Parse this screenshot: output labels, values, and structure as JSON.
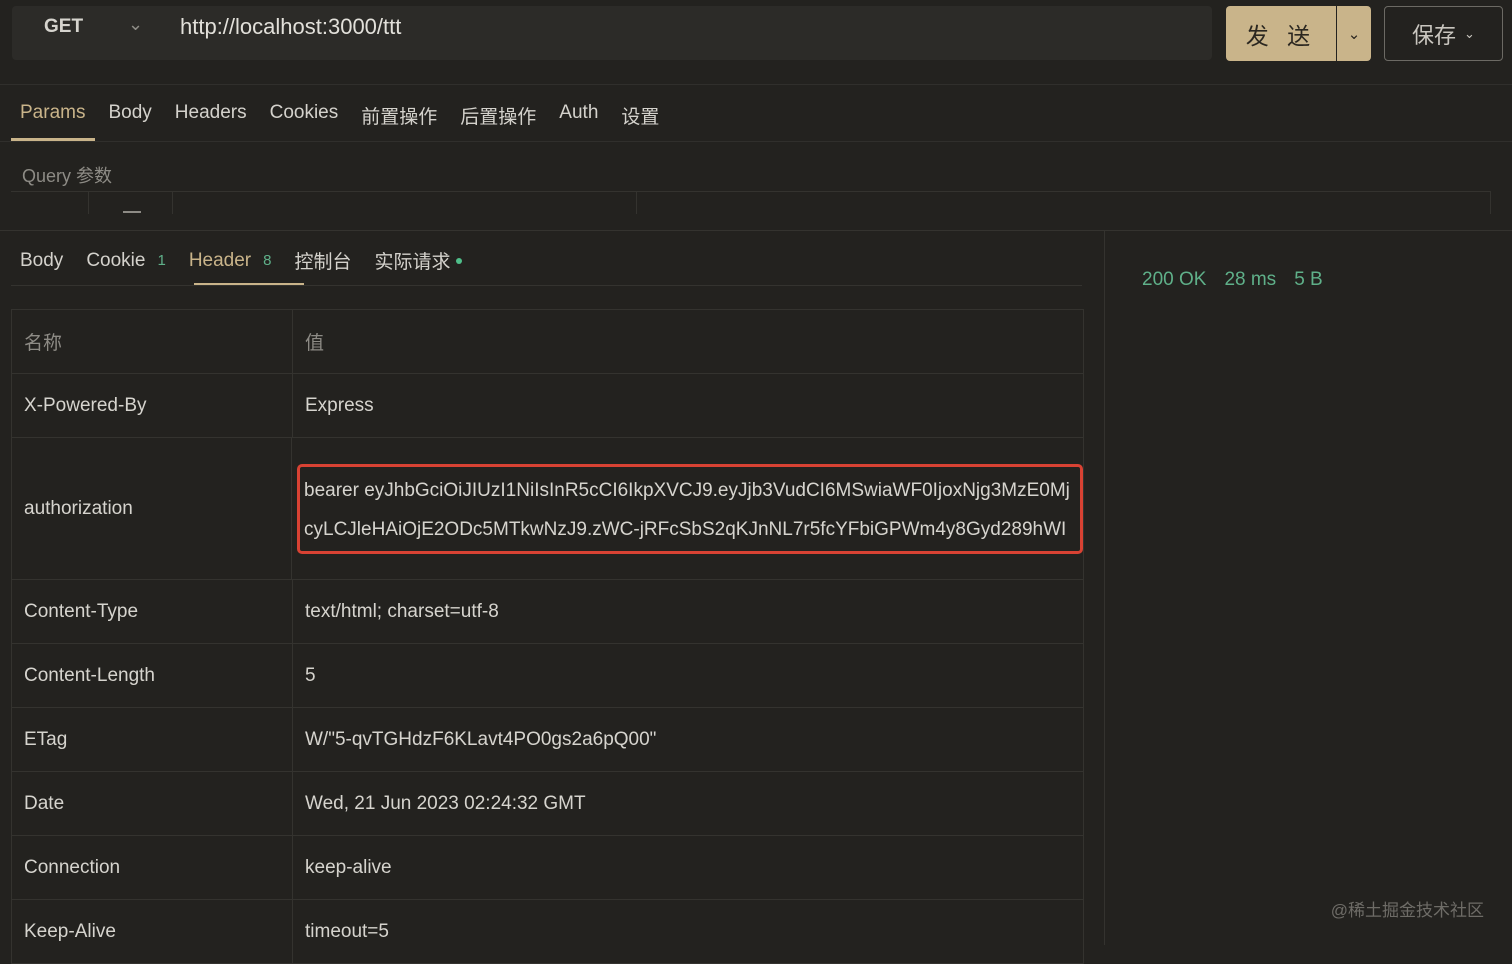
{
  "request": {
    "method": "GET",
    "url": "http://localhost:3000/ttt",
    "send_label": "发 送",
    "save_label": "保存"
  },
  "request_tabs": [
    "Params",
    "Body",
    "Headers",
    "Cookies",
    "前置操作",
    "后置操作",
    "Auth",
    "设置"
  ],
  "query_label": "Query 参数",
  "response_tabs": {
    "body": "Body",
    "cookie": "Cookie",
    "cookie_count": "1",
    "header": "Header",
    "header_count": "8",
    "console": "控制台",
    "actual_request": "实际请求"
  },
  "status": {
    "code": "200 OK",
    "time": "28 ms",
    "size": "5 B"
  },
  "headers_table": {
    "col_name": "名称",
    "col_value": "值",
    "rows": [
      {
        "name": "X-Powered-By",
        "value": "Express"
      },
      {
        "name": "authorization",
        "value": "bearer eyJhbGciOiJIUzI1NiIsInR5cCI6IkpXVCJ9.eyJjb3VudCI6MSwiaWF0IjoxNjg3MzE0MjcyLCJleHAiOjE2ODc5MTkwNzJ9.zWC-jRFcSbS2qKJnNL7r5fcYFbiGPWm4y8Gyd289hWI"
      },
      {
        "name": "Content-Type",
        "value": "text/html; charset=utf-8"
      },
      {
        "name": "Content-Length",
        "value": "5"
      },
      {
        "name": "ETag",
        "value": "W/\"5-qvTGHdzF6KLavt4PO0gs2a6pQ00\""
      },
      {
        "name": "Date",
        "value": "Wed, 21 Jun 2023 02:24:32 GMT"
      },
      {
        "name": "Connection",
        "value": "keep-alive"
      },
      {
        "name": "Keep-Alive",
        "value": "timeout=5"
      }
    ]
  },
  "watermark": "@稀土掘金技术社区",
  "colors": {
    "accent": "#c9b48a",
    "success": "#5fb089",
    "highlight": "#d84233",
    "background": "#23221f"
  }
}
